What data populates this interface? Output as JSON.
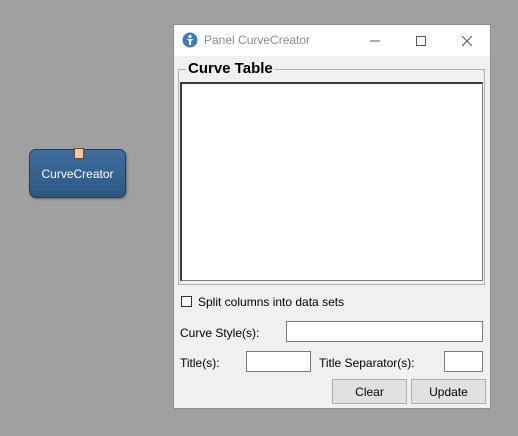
{
  "canvas": {
    "node_label": "CurveCreator"
  },
  "window": {
    "title": "Panel CurveCreator"
  },
  "curve_table": {
    "title": "Curve Table"
  },
  "split_columns": {
    "label": "Split columns into data sets",
    "checked": false
  },
  "curve_style": {
    "label": "Curve Style(s):",
    "value": ""
  },
  "titles": {
    "label": "Title(s):",
    "value": ""
  },
  "title_separator": {
    "label": "Title Separator(s):",
    "value": ""
  },
  "buttons": {
    "clear": "Clear",
    "update": "Update"
  },
  "colors": {
    "node_fill": "#3a6795",
    "port_fill": "#f6c9a0",
    "canvas_bg": "#a0a0a0"
  }
}
